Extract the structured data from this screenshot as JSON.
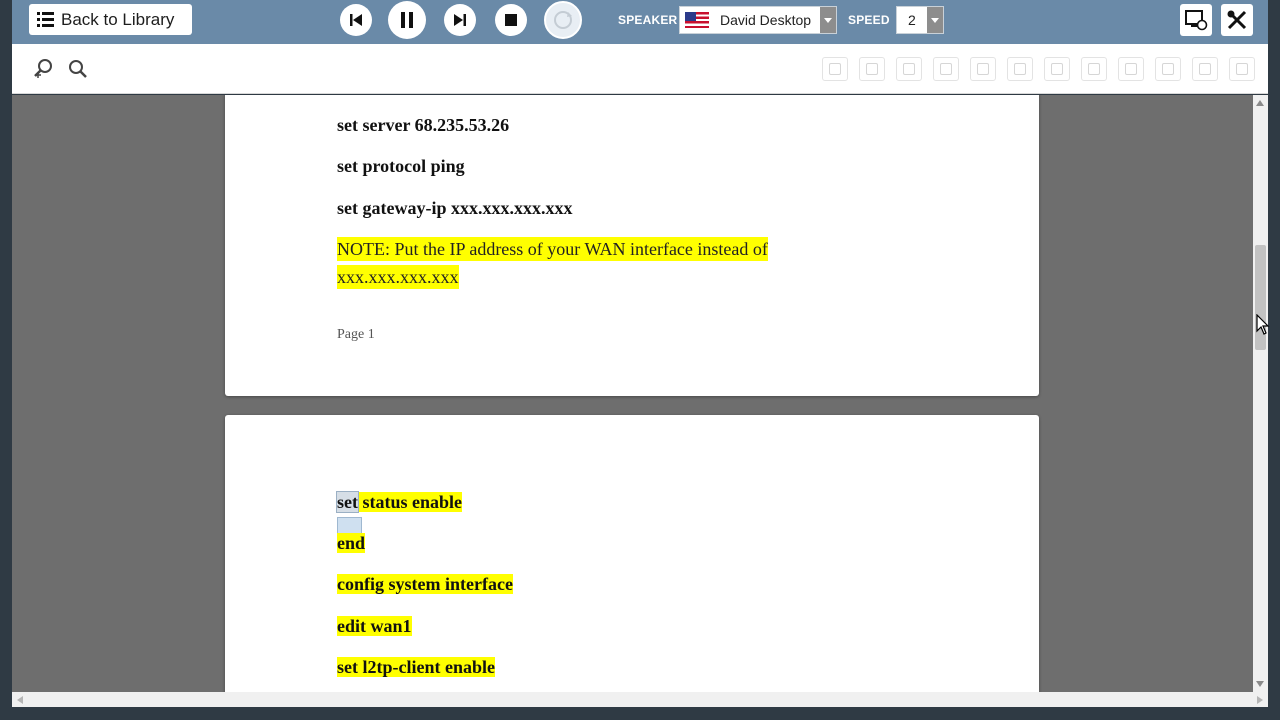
{
  "topbar": {
    "back_label": "Back to Library",
    "speaker_label": "SPEAKER",
    "speaker_value": "David Desktop",
    "speed_label": "SPEED",
    "speed_value": "2"
  },
  "document": {
    "page1": {
      "lines": [
        "set server 68.235.53.26",
        "set protocol ping",
        "set gateway-ip xxx.xxx.xxx.xxx"
      ],
      "note_line1": "NOTE: Put the IP address of your WAN  interface instead of",
      "note_line2": "xxx.xxx.xxx.xxx",
      "page_number": "Page 1"
    },
    "page2": {
      "current_word": "set",
      "first_line_rest": " status enable",
      "lines": [
        "end",
        "config system interface",
        "edit wan1",
        "set l2tp-client enable"
      ]
    }
  },
  "colors": {
    "topbar": "#6a8aa8",
    "highlight": "#ffff00",
    "viewer_bg": "#6e6e6e"
  }
}
